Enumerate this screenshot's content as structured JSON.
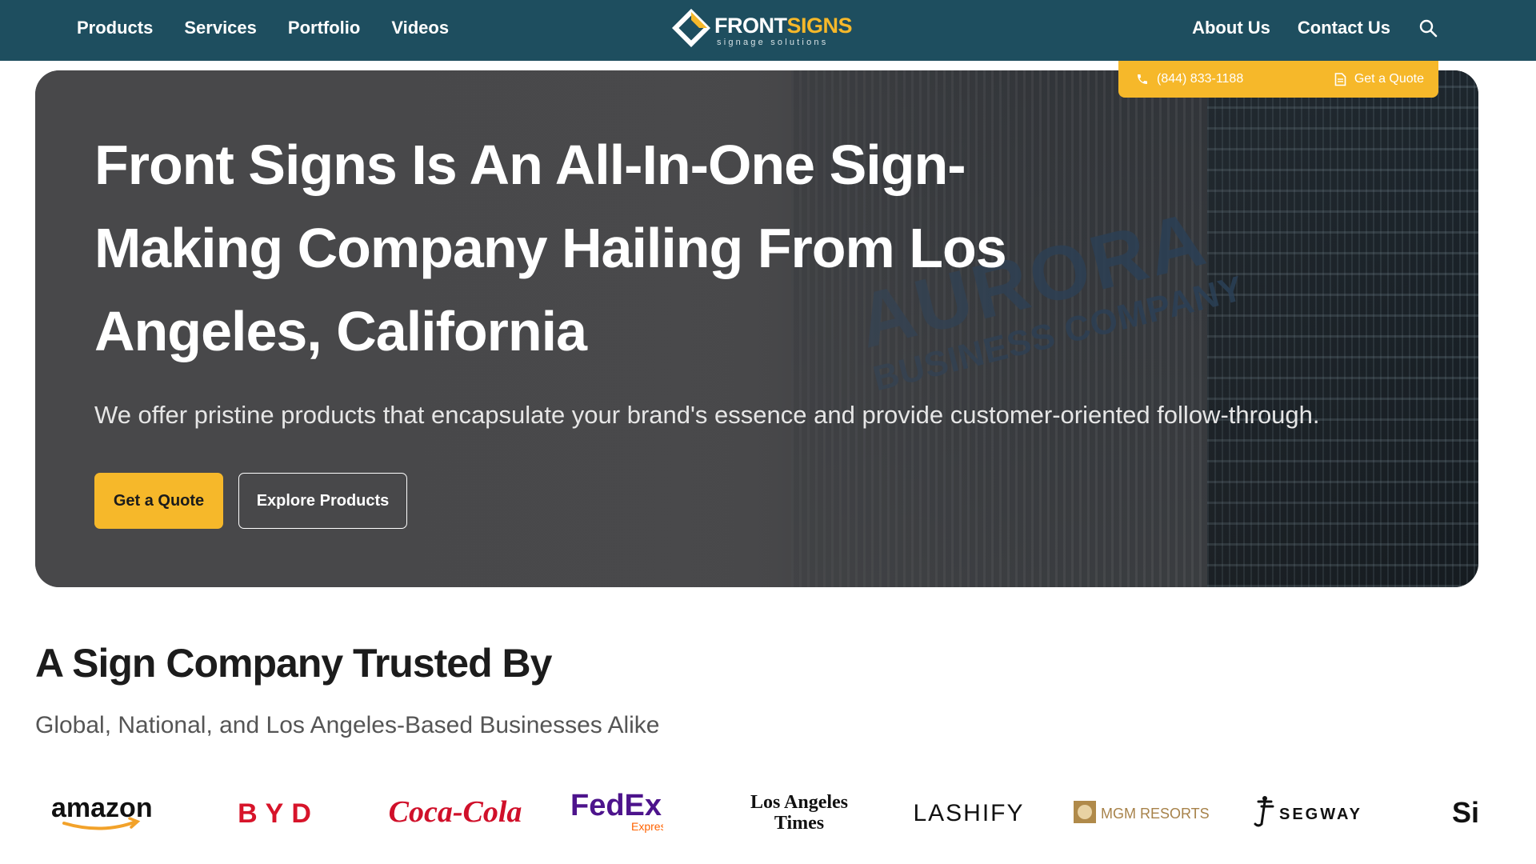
{
  "nav": {
    "left_links": [
      {
        "label": "Products"
      },
      {
        "label": "Services"
      },
      {
        "label": "Portfolio"
      },
      {
        "label": "Videos"
      }
    ],
    "logo": {
      "word_white": "FRONT",
      "word_yellow": "SIGNS",
      "tagline": "signage solutions"
    },
    "right_links": [
      {
        "label": "About Us"
      },
      {
        "label": "Contact Us"
      }
    ]
  },
  "topbar": {
    "phone": "(844) 833-1188",
    "quote": "Get a Quote"
  },
  "hero": {
    "title": "Front Signs Is An All-In-One Sign-Making Company Hailing From Los Angeles, California",
    "subtitle": "We offer pristine products that encapsulate your brand's essence and provide customer-oriented follow-through.",
    "primary_button": "Get a Quote",
    "secondary_button": "Explore Products",
    "building_sign_big": "AURORA",
    "building_sign_small": "BUSINESS COMPANY"
  },
  "trusted": {
    "title": "A Sign Company Trusted By",
    "subtitle": "Global, National, and Los Angeles-Based Businesses Alike",
    "brands": [
      "amazon",
      "BYD",
      "Coca-Cola",
      "FedEx",
      "Express",
      "Los Angeles",
      "Times",
      "LASHIFY",
      "MGM RESORTS",
      "SEGWAY",
      "Si"
    ]
  },
  "colors": {
    "nav_bg": "#1e4e5f",
    "accent": "#f6b82a"
  },
  "icons": [
    "phone-icon",
    "document-icon",
    "search-icon"
  ]
}
